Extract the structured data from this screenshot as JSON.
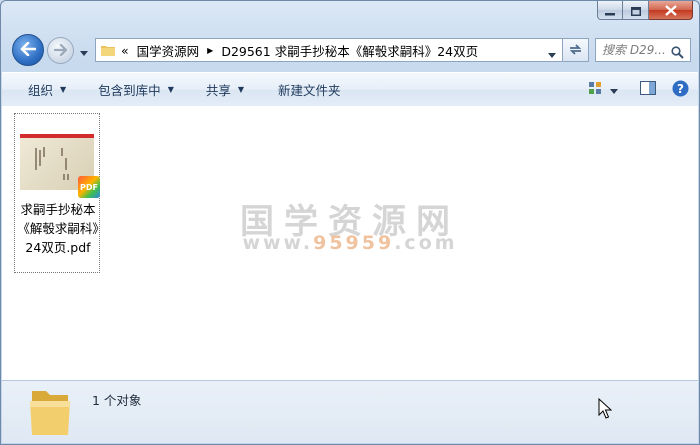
{
  "window": {
    "caption_buttons": [
      "minimize-icon",
      "maximize-icon",
      "close-icon"
    ],
    "accent": "#2e6fc4",
    "close_color": "#c23a20"
  },
  "nav": {
    "breadcrumb_prefix": "«",
    "breadcrumb": [
      "国学资源网",
      "D29561 求嗣手抄秘本《解彀求嗣科》24双页"
    ],
    "search_placeholder": "搜索 D29..."
  },
  "toolbar": {
    "organize": "组织",
    "include_in_library": "包含到库中",
    "share": "共享",
    "new_folder": "新建文件夹"
  },
  "files": [
    {
      "name": "求嗣手抄秘本《解彀求嗣科》24双页.pdf",
      "badge": "PDF"
    }
  ],
  "watermark": {
    "line1": "国学资源网",
    "line2_a": "www.",
    "line2_b": "95959",
    "line2_c": ".com"
  },
  "status": {
    "count_text": "1 个对象"
  }
}
